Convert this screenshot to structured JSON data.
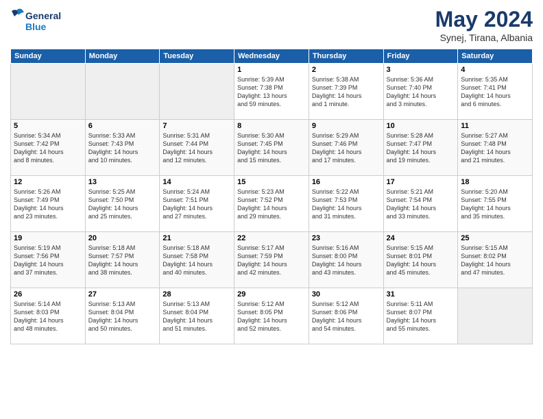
{
  "header": {
    "logo_line1": "General",
    "logo_line2": "Blue",
    "month_year": "May 2024",
    "location": "Synej, Tirana, Albania"
  },
  "days_of_week": [
    "Sunday",
    "Monday",
    "Tuesday",
    "Wednesday",
    "Thursday",
    "Friday",
    "Saturday"
  ],
  "weeks": [
    {
      "days": [
        {
          "num": "",
          "content": ""
        },
        {
          "num": "",
          "content": ""
        },
        {
          "num": "",
          "content": ""
        },
        {
          "num": "1",
          "content": "Sunrise: 5:39 AM\nSunset: 7:38 PM\nDaylight: 13 hours\nand 59 minutes."
        },
        {
          "num": "2",
          "content": "Sunrise: 5:38 AM\nSunset: 7:39 PM\nDaylight: 14 hours\nand 1 minute."
        },
        {
          "num": "3",
          "content": "Sunrise: 5:36 AM\nSunset: 7:40 PM\nDaylight: 14 hours\nand 3 minutes."
        },
        {
          "num": "4",
          "content": "Sunrise: 5:35 AM\nSunset: 7:41 PM\nDaylight: 14 hours\nand 6 minutes."
        }
      ]
    },
    {
      "days": [
        {
          "num": "5",
          "content": "Sunrise: 5:34 AM\nSunset: 7:42 PM\nDaylight: 14 hours\nand 8 minutes."
        },
        {
          "num": "6",
          "content": "Sunrise: 5:33 AM\nSunset: 7:43 PM\nDaylight: 14 hours\nand 10 minutes."
        },
        {
          "num": "7",
          "content": "Sunrise: 5:31 AM\nSunset: 7:44 PM\nDaylight: 14 hours\nand 12 minutes."
        },
        {
          "num": "8",
          "content": "Sunrise: 5:30 AM\nSunset: 7:45 PM\nDaylight: 14 hours\nand 15 minutes."
        },
        {
          "num": "9",
          "content": "Sunrise: 5:29 AM\nSunset: 7:46 PM\nDaylight: 14 hours\nand 17 minutes."
        },
        {
          "num": "10",
          "content": "Sunrise: 5:28 AM\nSunset: 7:47 PM\nDaylight: 14 hours\nand 19 minutes."
        },
        {
          "num": "11",
          "content": "Sunrise: 5:27 AM\nSunset: 7:48 PM\nDaylight: 14 hours\nand 21 minutes."
        }
      ]
    },
    {
      "days": [
        {
          "num": "12",
          "content": "Sunrise: 5:26 AM\nSunset: 7:49 PM\nDaylight: 14 hours\nand 23 minutes."
        },
        {
          "num": "13",
          "content": "Sunrise: 5:25 AM\nSunset: 7:50 PM\nDaylight: 14 hours\nand 25 minutes."
        },
        {
          "num": "14",
          "content": "Sunrise: 5:24 AM\nSunset: 7:51 PM\nDaylight: 14 hours\nand 27 minutes."
        },
        {
          "num": "15",
          "content": "Sunrise: 5:23 AM\nSunset: 7:52 PM\nDaylight: 14 hours\nand 29 minutes."
        },
        {
          "num": "16",
          "content": "Sunrise: 5:22 AM\nSunset: 7:53 PM\nDaylight: 14 hours\nand 31 minutes."
        },
        {
          "num": "17",
          "content": "Sunrise: 5:21 AM\nSunset: 7:54 PM\nDaylight: 14 hours\nand 33 minutes."
        },
        {
          "num": "18",
          "content": "Sunrise: 5:20 AM\nSunset: 7:55 PM\nDaylight: 14 hours\nand 35 minutes."
        }
      ]
    },
    {
      "days": [
        {
          "num": "19",
          "content": "Sunrise: 5:19 AM\nSunset: 7:56 PM\nDaylight: 14 hours\nand 37 minutes."
        },
        {
          "num": "20",
          "content": "Sunrise: 5:18 AM\nSunset: 7:57 PM\nDaylight: 14 hours\nand 38 minutes."
        },
        {
          "num": "21",
          "content": "Sunrise: 5:18 AM\nSunset: 7:58 PM\nDaylight: 14 hours\nand 40 minutes."
        },
        {
          "num": "22",
          "content": "Sunrise: 5:17 AM\nSunset: 7:59 PM\nDaylight: 14 hours\nand 42 minutes."
        },
        {
          "num": "23",
          "content": "Sunrise: 5:16 AM\nSunset: 8:00 PM\nDaylight: 14 hours\nand 43 minutes."
        },
        {
          "num": "24",
          "content": "Sunrise: 5:15 AM\nSunset: 8:01 PM\nDaylight: 14 hours\nand 45 minutes."
        },
        {
          "num": "25",
          "content": "Sunrise: 5:15 AM\nSunset: 8:02 PM\nDaylight: 14 hours\nand 47 minutes."
        }
      ]
    },
    {
      "days": [
        {
          "num": "26",
          "content": "Sunrise: 5:14 AM\nSunset: 8:03 PM\nDaylight: 14 hours\nand 48 minutes."
        },
        {
          "num": "27",
          "content": "Sunrise: 5:13 AM\nSunset: 8:04 PM\nDaylight: 14 hours\nand 50 minutes."
        },
        {
          "num": "28",
          "content": "Sunrise: 5:13 AM\nSunset: 8:04 PM\nDaylight: 14 hours\nand 51 minutes."
        },
        {
          "num": "29",
          "content": "Sunrise: 5:12 AM\nSunset: 8:05 PM\nDaylight: 14 hours\nand 52 minutes."
        },
        {
          "num": "30",
          "content": "Sunrise: 5:12 AM\nSunset: 8:06 PM\nDaylight: 14 hours\nand 54 minutes."
        },
        {
          "num": "31",
          "content": "Sunrise: 5:11 AM\nSunset: 8:07 PM\nDaylight: 14 hours\nand 55 minutes."
        },
        {
          "num": "",
          "content": ""
        }
      ]
    }
  ]
}
